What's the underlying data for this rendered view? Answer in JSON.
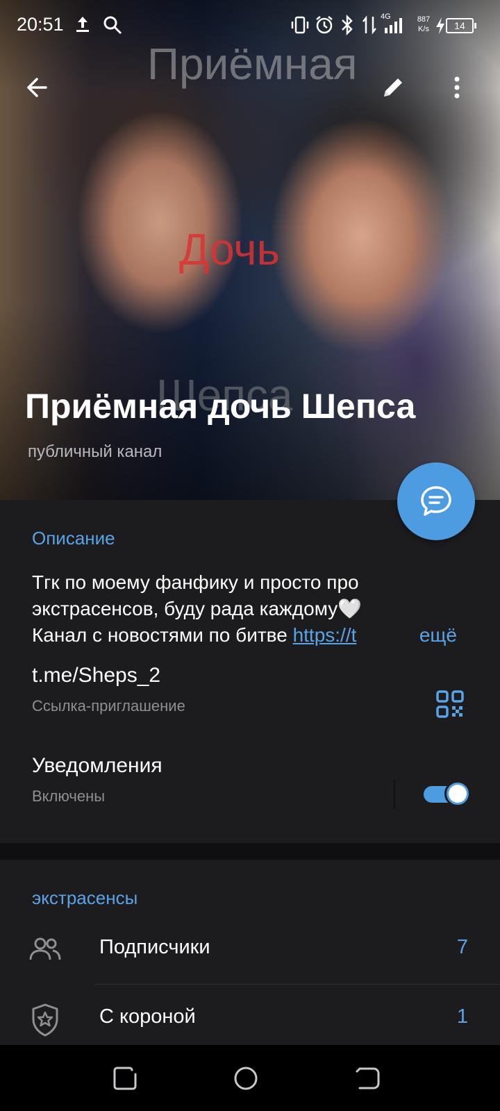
{
  "status_bar": {
    "time": "20:51",
    "network_type": "4G",
    "speed_value": "887",
    "speed_unit": "K/s",
    "battery": "14"
  },
  "hero": {
    "watermark_1": "Приёмная",
    "watermark_2": "Дочь",
    "watermark_3": "Шепса",
    "channel_title": "Приёмная дочь Шепса",
    "channel_subtitle": "публичный канал"
  },
  "app_bar": {
    "back_icon": "arrow-left-icon",
    "edit_icon": "pencil-icon",
    "more_icon": "more-vertical-icon"
  },
  "fab": {
    "icon": "chat-bubble-icon"
  },
  "info": {
    "description_header": "Описание",
    "description_line_1": "Тгк по моему фанфику и просто про",
    "description_line_2": "экстрасенсов, буду рада каждому🤍",
    "description_line_3_text": "Канал с новостями по битве ",
    "description_line_3_link": "https://t",
    "description_more": "ещё",
    "link_value": "t.me/Sheps_2",
    "link_label": "Ссылка-приглашение",
    "notifications_title": "Уведомления",
    "notifications_status": "Включены",
    "notifications_enabled": true
  },
  "members_section": {
    "header": "экстрасенсы",
    "rows": [
      {
        "icon": "people-icon",
        "label": "Подписчики",
        "count": "7"
      },
      {
        "icon": "shield-star-icon",
        "label": "С короной",
        "count": "1"
      }
    ]
  },
  "colors": {
    "accent": "#5aa3e6",
    "fab": "#4d9be0",
    "card_bg": "#1c1c1e",
    "page_bg": "#0f0f11"
  }
}
